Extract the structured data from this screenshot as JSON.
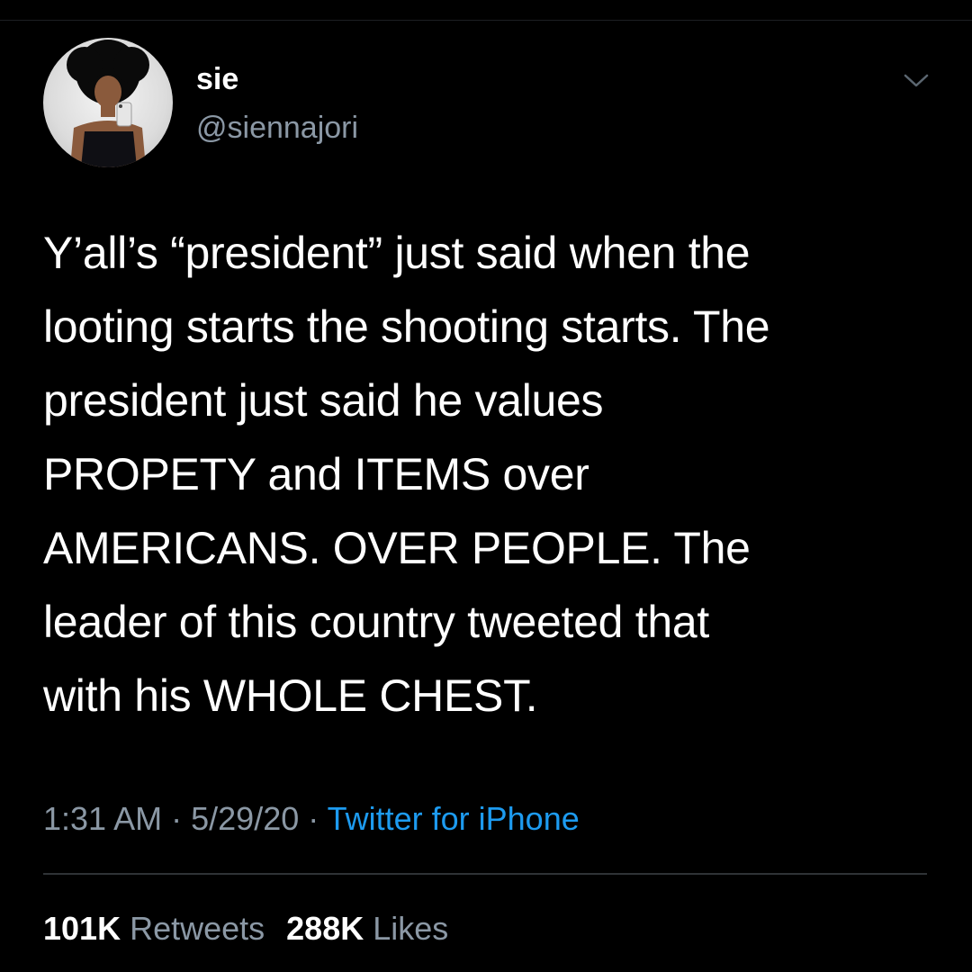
{
  "colors": {
    "background": "#000000",
    "primary_text": "#ffffff",
    "secondary_text": "#8b98a5",
    "link": "#1d9bf0",
    "divider": "#2f3336"
  },
  "user": {
    "display_name": "sie",
    "handle": "@siennajori",
    "avatar_icon": "profile-photo"
  },
  "menu": {
    "icon": "chevron-down-icon"
  },
  "tweet": {
    "text": "Y’all’s “president” just said when the\nlooting starts the shooting starts. The\npresident just said he values\nPROPETY and ITEMS over\nAMERICANS. OVER PEOPLE. The\nleader of this country tweeted that\nwith his WHOLE CHEST.",
    "time": "1:31 AM",
    "separator": "·",
    "date": "5/29/20",
    "source": "Twitter for iPhone"
  },
  "stats": {
    "retweets_count": "101K",
    "retweets_label": "Retweets",
    "likes_count": "288K",
    "likes_label": "Likes"
  }
}
